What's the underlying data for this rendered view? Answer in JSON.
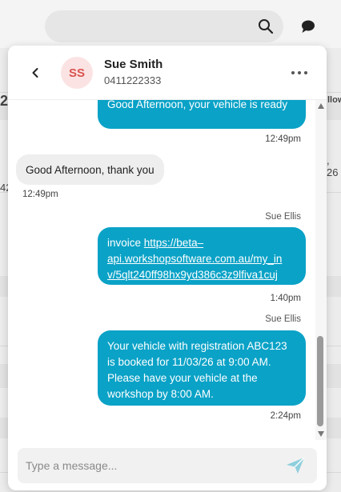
{
  "contact": {
    "initials": "SS",
    "name": "Sue Smith",
    "phone": "0411222333"
  },
  "background": {
    "edge_texts": [
      "llow",
      "2",
      ", 26",
      "42"
    ]
  },
  "messages": [
    {
      "direction": "out",
      "text": "Good Afternoon, your vehicle is ready",
      "time": "12:49pm"
    },
    {
      "direction": "in",
      "text": "Good Afternoon, thank you",
      "time": "12:49pm"
    },
    {
      "direction": "out",
      "sender": "Sue Ellis",
      "prefix": "invoice ",
      "link": "https://beta-api.workshopsoftware.com.au/my_inv/5qlt240ff98hx9yd386c3z9lfiva1cuj",
      "link_line1": "https://beta–",
      "link_line2": "api.workshopsoftware.com.au/my_in",
      "link_line3": "v/5qlt240ff98hx9yd386c3z9lfiva1cuj",
      "time": "1:40pm"
    },
    {
      "direction": "out",
      "sender": "Sue Ellis",
      "text": "Your vehicle with registration ABC123 is booked for 11/03/26 at 9:00 AM. Please have your vehicle at the workshop by 8:00 AM.",
      "time": "2:24pm"
    }
  ],
  "composer": {
    "placeholder": "Type a message..."
  },
  "icons": {
    "back": "chevron-left-icon",
    "more": "more-horizontal-icon",
    "send": "send-icon",
    "search": "search-icon",
    "chat": "chat-bubble-icon"
  },
  "colors": {
    "accent": "#0aa2c7",
    "avatar_bg": "#fbe3e3",
    "avatar_text": "#d9534f",
    "incoming_bg": "#eeeeee"
  }
}
